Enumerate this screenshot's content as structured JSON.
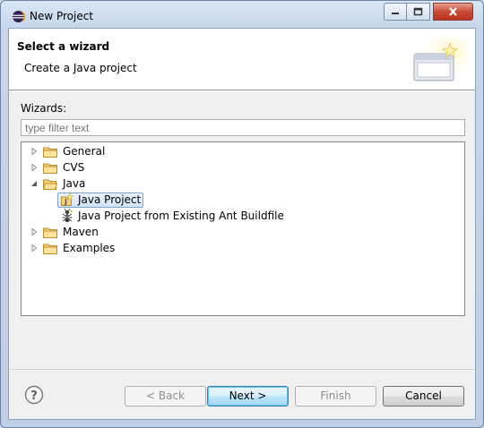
{
  "window": {
    "title": "New Project"
  },
  "titlebar": {
    "icons": [
      "eclipse-icon",
      "minimize-icon",
      "maximize-icon",
      "close-icon"
    ]
  },
  "banner": {
    "title": "Select a wizard",
    "description": "Create a Java project",
    "image_icon": "new-wizard-banner-icon"
  },
  "wizards": {
    "label": "Wizards:",
    "filter_placeholder": "type filter text",
    "filter_value": ""
  },
  "tree": {
    "items": [
      {
        "label": "General",
        "expanded": false
      },
      {
        "label": "CVS",
        "expanded": false
      },
      {
        "label": "Java",
        "expanded": true,
        "children": [
          {
            "label": "Java Project",
            "selected": true,
            "icon": "java-project-icon"
          },
          {
            "label": "Java Project from Existing Ant Buildfile",
            "icon": "ant-icon"
          }
        ]
      },
      {
        "label": "Maven",
        "expanded": false
      },
      {
        "label": "Examples",
        "expanded": false
      }
    ]
  },
  "buttons": {
    "help_icon": "help-icon",
    "back": "< Back",
    "next": "Next >",
    "finish": "Finish",
    "cancel": "Cancel"
  },
  "colors": {
    "selection": "#d2e4f9",
    "frame": "#c6d6ea",
    "close": "#c94a35"
  }
}
